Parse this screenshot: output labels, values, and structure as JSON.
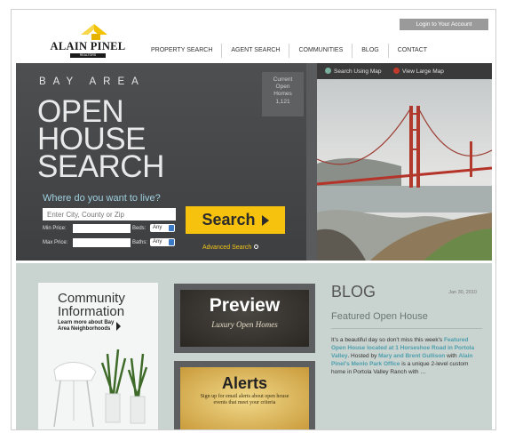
{
  "header": {
    "login_button": "Login to Your Account",
    "logo_text": "ALAIN PINEL",
    "logo_sub": "REALTORS",
    "nav": [
      "PROPERTY SEARCH",
      "AGENT SEARCH",
      "COMMUNITIES",
      "BLOG",
      "CONTACT"
    ]
  },
  "hero": {
    "bay": "BAY AREA",
    "line1": "OPEN",
    "line2": "HOUSE",
    "line3": "SEARCH",
    "current_label_1": "Current",
    "current_label_2": "Open",
    "current_label_3": "Homes",
    "current_count": "1,121",
    "where_label": "Where do you want to live?",
    "city_placeholder": "Enter City, County or Zip",
    "min_price_label": "Min Price:",
    "max_price_label": "Max Price:",
    "beds_label": "Beds:",
    "baths_label": "Baths:",
    "beds_value": "Any",
    "baths_value": "Any",
    "search_button": "Search",
    "advanced_search": "Advanced Search"
  },
  "map": {
    "search_using_map": "Search Using Map",
    "view_large_map": "View Large Map"
  },
  "lower": {
    "community_title_1": "Community",
    "community_title_2": "Information",
    "community_learn": "Learn more about Bay Area Neighborhoods",
    "preview_title": "Preview",
    "preview_sub": "Luxury Open Homes",
    "alerts_title": "Alerts",
    "alerts_sub": "Sign up for email alerts about open house events that meet your criteria",
    "blog_title": "BLOG",
    "blog_date": "Jan 30, 2010",
    "blog_subtitle": "Featured Open House",
    "blog_text_1": "It's a beautiful day so don't miss this week's",
    "blog_link_1": "Featured Open House located at 1 Horseshoe Road in Portola Valley",
    "blog_text_2": ". Hosted by",
    "blog_link_2": "Mary and Brent Gullison",
    "blog_text_3": "with",
    "blog_link_3": "Alain Pinel's Menlo Park Office",
    "blog_text_4": "is a unique 2-level custom home in Portola Valley Ranch with …"
  }
}
